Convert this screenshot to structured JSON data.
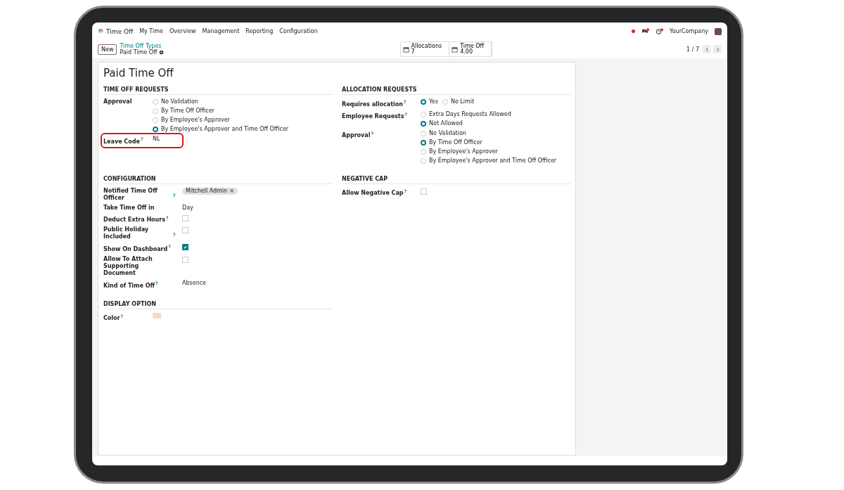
{
  "navbar": {
    "app_name": "Time Off",
    "menu": [
      "My Time",
      "Overview",
      "Management",
      "Reporting",
      "Configuration"
    ],
    "company": "YourCompany"
  },
  "control_panel": {
    "new_button": "New",
    "breadcrumb": "Time Off Types",
    "record": "Paid Time Off",
    "stat_buttons": [
      {
        "label": "Allocations",
        "value": "7"
      },
      {
        "label": "Time Off",
        "value": "4.00"
      }
    ],
    "pager": "1 / 7"
  },
  "form": {
    "title": "Paid Time Off",
    "rows": [
      {
        "sections": [
          {
            "title": "TIME OFF REQUESTS",
            "fields": [
              {
                "kind": "radio",
                "label": "Approval",
                "options": [
                  {
                    "label": "No Validation",
                    "selected": false
                  },
                  {
                    "label": "By Time Off Officer",
                    "selected": false
                  },
                  {
                    "label": "By Employee's Approver",
                    "selected": false
                  },
                  {
                    "label": "By Employee's Approver and Time Off Officer",
                    "selected": true
                  }
                ]
              },
              {
                "kind": "text",
                "label": "Leave Code",
                "help": "?",
                "value": "NL",
                "highlighted": true
              }
            ]
          },
          {
            "title": "ALLOCATION REQUESTS",
            "fields": [
              {
                "kind": "radio_inline",
                "label": "Requires allocation",
                "help": "?",
                "options": [
                  {
                    "label": "Yes",
                    "selected": true
                  },
                  {
                    "label": "No Limit",
                    "selected": false
                  }
                ]
              },
              {
                "kind": "radio",
                "label": "Employee Requests",
                "help": "?",
                "options": [
                  {
                    "label": "Extra Days Requests Allowed",
                    "selected": false
                  },
                  {
                    "label": "Not Allowed",
                    "selected": true
                  }
                ]
              },
              {
                "kind": "radio",
                "label": "Approval",
                "help": "?",
                "options": [
                  {
                    "label": "No Validation",
                    "selected": false
                  },
                  {
                    "label": "By Time Off Officer",
                    "selected": true
                  },
                  {
                    "label": "By Employee's Approver",
                    "selected": false
                  },
                  {
                    "label": "By Employee's Approver and Time Off Officer",
                    "selected": false
                  }
                ]
              }
            ]
          }
        ]
      },
      {
        "sections": [
          {
            "title": "CONFIGURATION",
            "fields": [
              {
                "kind": "tags",
                "label": "Notified Time Off Officer",
                "help": "?",
                "tags": [
                  {
                    "label": "Mitchell Admin",
                    "remove": "×"
                  }
                ]
              },
              {
                "kind": "text",
                "label": "Take Time Off in",
                "value": "Day"
              },
              {
                "kind": "checkbox",
                "label": "Deduct Extra Hours",
                "help": "?",
                "checked": false
              },
              {
                "kind": "checkbox",
                "label": "Public Holiday Included",
                "help": "?",
                "checked": false
              },
              {
                "kind": "checkbox",
                "label": "Show On Dashboard",
                "help": "?",
                "checked": true
              },
              {
                "kind": "checkbox",
                "label": "Allow To Attach Supporting Document",
                "checked": false
              },
              {
                "kind": "text",
                "label": "Kind of Time Off",
                "help": "?",
                "value": "Absence"
              }
            ]
          },
          {
            "title": "NEGATIVE CAP",
            "fields": [
              {
                "kind": "checkbox",
                "label": "Allow Negative Cap",
                "help": "?",
                "checked": false
              }
            ]
          }
        ]
      },
      {
        "sections": [
          {
            "title": "DISPLAY OPTION",
            "fields": [
              {
                "kind": "color",
                "label": "Color",
                "help": "?",
                "color": "#f1dcc0"
              }
            ]
          }
        ]
      }
    ]
  }
}
